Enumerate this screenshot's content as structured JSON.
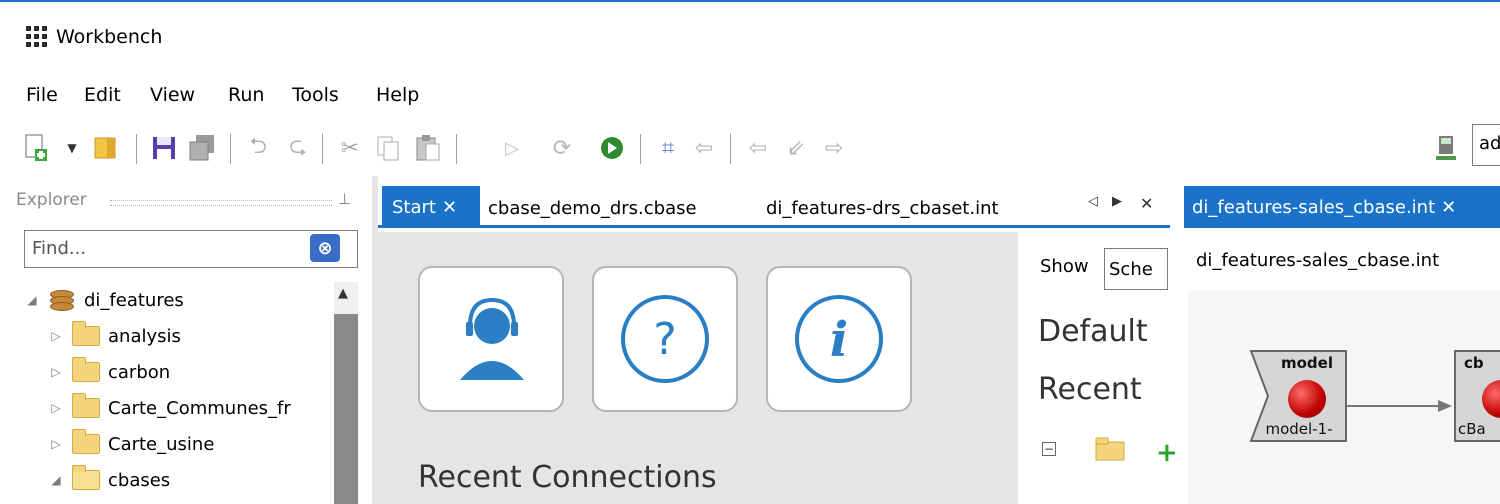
{
  "window": {
    "title": "Workbench"
  },
  "menu": [
    "File",
    "Edit",
    "View",
    "Run",
    "Tools",
    "Help"
  ],
  "toolbar": {
    "icons": [
      "new-file-icon",
      "dropdown-arrow-icon",
      "open-icon",
      "save-icon",
      "save-all-icon",
      "undo-icon",
      "redo-icon",
      "cut-icon",
      "copy-icon",
      "paste-icon",
      "run-icon",
      "refresh-icon",
      "go-icon",
      "grid-icon",
      "back-icon",
      "nav-back-icon",
      "nav-import-icon",
      "nav-forward-icon"
    ],
    "search_value": "ad"
  },
  "explorer": {
    "label": "Explorer",
    "find_placeholder": "Find...",
    "tree": [
      {
        "label": "di_features",
        "expanded": true,
        "level": 0,
        "icon": "database"
      },
      {
        "label": "analysis",
        "expanded": false,
        "level": 1,
        "icon": "folder"
      },
      {
        "label": "carbon",
        "expanded": false,
        "level": 1,
        "icon": "folder"
      },
      {
        "label": "Carte_Communes_fr",
        "expanded": false,
        "level": 1,
        "icon": "folder"
      },
      {
        "label": "Carte_usine",
        "expanded": false,
        "level": 1,
        "icon": "folder"
      },
      {
        "label": "cbases",
        "expanded": true,
        "level": 1,
        "icon": "folder-open"
      }
    ]
  },
  "editor": {
    "tabs": [
      {
        "label": "Start",
        "active": true
      },
      {
        "label": "cbase_demo_drs.cbase",
        "active": false
      },
      {
        "label": "di_features-drs_cbaset.int",
        "active": false
      }
    ],
    "start": {
      "cards": [
        "support-icon",
        "help-icon",
        "info-icon"
      ],
      "recent_connections": "Recent Connections"
    },
    "side": {
      "show_label": "Show",
      "show_value": "Sche",
      "default_heading": "Default",
      "recent_heading": "Recent"
    }
  },
  "right_editor": {
    "tab_label": "di_features-sales_cbase.int",
    "subtitle": "di_features-sales_cbase.int",
    "nodes": [
      {
        "title": "model",
        "sub": "model-1-"
      },
      {
        "title": "cb",
        "sub": "cBa"
      }
    ]
  },
  "colors": {
    "accent": "#1a73c8",
    "tab_text": "#ffffff",
    "panel_bg": "#e5e5e5"
  }
}
